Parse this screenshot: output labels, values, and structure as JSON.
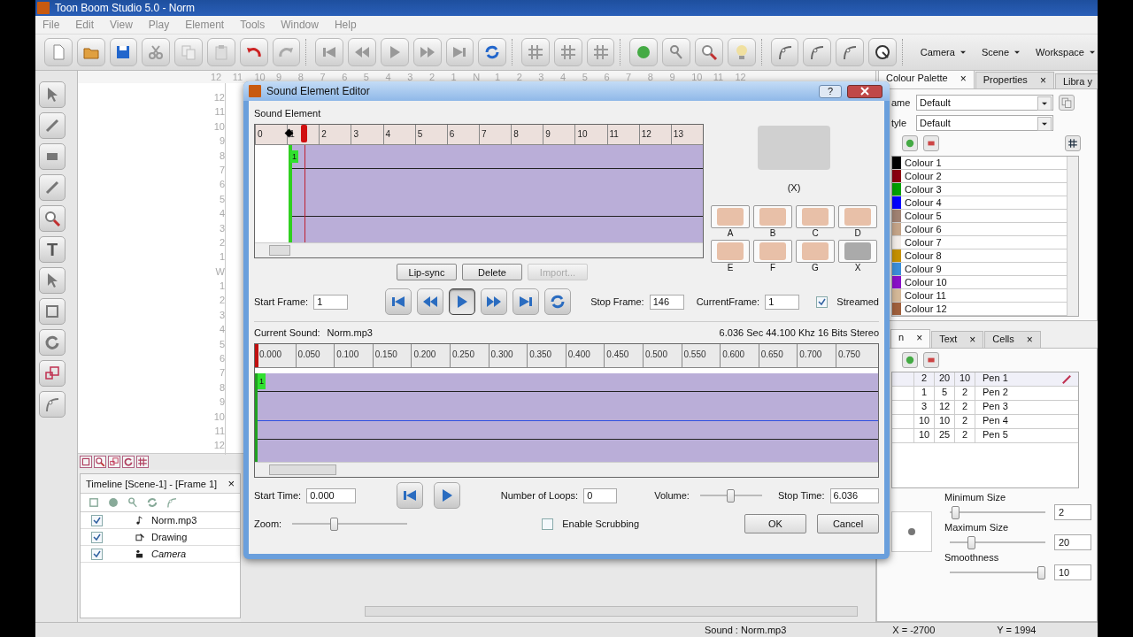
{
  "window": {
    "title": "Toon Boom Studio 5.0 - Norm"
  },
  "menu": [
    "File",
    "Edit",
    "View",
    "Play",
    "Element",
    "Tools",
    "Window",
    "Help"
  ],
  "toolbar_menus": [
    "Camera",
    "Scene",
    "Workspace"
  ],
  "text_tool": {
    "label": "T"
  },
  "canvas": {
    "top_ruler": [
      "12",
      "11",
      "10",
      "9",
      "8",
      "7",
      "6",
      "5",
      "4",
      "3",
      "2",
      "1",
      "N",
      "1",
      "2",
      "3",
      "4",
      "5",
      "6",
      "7",
      "8",
      "9",
      "10",
      "11",
      "12"
    ],
    "side_ruler": [
      "12",
      "11",
      "10",
      "9",
      "8",
      "7",
      "6",
      "5",
      "4",
      "3",
      "2",
      "1",
      "W",
      "1",
      "2",
      "3",
      "4",
      "5",
      "6",
      "7",
      "8",
      "9",
      "10",
      "11",
      "12"
    ]
  },
  "timeline": {
    "title": "Timeline [Scene-1] - [Frame 1]",
    "close": "×",
    "layers": [
      {
        "name": "Norm.mp3",
        "checked": true,
        "kind": "sound"
      },
      {
        "name": "Drawing",
        "checked": true,
        "kind": "drawing"
      },
      {
        "name": "Camera",
        "checked": true,
        "kind": "camera"
      }
    ]
  },
  "status_bar": [
    "Sound : Norm.mp3",
    "X = -2700",
    "Y = 1994"
  ],
  "right_panel": {
    "tabs": [
      {
        "label": "Colour Palette",
        "close": "×",
        "selected": true
      },
      {
        "label": "Properties",
        "close": "×",
        "selected": false
      },
      {
        "label": "Libra y",
        "selected": false
      }
    ],
    "name_label": "ame",
    "name_value": "Default",
    "style_label": "tyle",
    "style_value": "Default",
    "colours": [
      {
        "name": "Colour 1",
        "color": "#000000"
      },
      {
        "name": "Colour 2",
        "color": "#8b0010"
      },
      {
        "name": "Colour 3",
        "color": "#00a000"
      },
      {
        "name": "Colour 4",
        "color": "#0000ff"
      },
      {
        "name": "Colour 5",
        "color": "#a08272"
      },
      {
        "name": "Colour 6",
        "color": "#c4a488"
      },
      {
        "name": "Colour 7",
        "color": "#f2ece8"
      },
      {
        "name": "Colour 8",
        "color": "#c49000"
      },
      {
        "name": "Colour 9",
        "color": "#3c8ed8"
      },
      {
        "name": "Colour 10",
        "color": "#8a10c8"
      },
      {
        "name": "Colour 11",
        "color": "#d4b898"
      },
      {
        "name": "Colour 12",
        "color": "#a0603c"
      }
    ],
    "lower_tabs": [
      {
        "label": "n",
        "close": "×",
        "selected": true
      },
      {
        "label": "Text",
        "close": "×",
        "selected": false
      },
      {
        "label": "Cells",
        "close": "×",
        "selected": false
      }
    ],
    "pens": [
      {
        "cells": [
          "2",
          "20",
          "10"
        ],
        "name": "Pen 1",
        "selected": true
      },
      {
        "cells": [
          "1",
          "5",
          "2"
        ],
        "name": "Pen 2",
        "selected": false
      },
      {
        "cells": [
          "3",
          "12",
          "2"
        ],
        "name": "Pen 3",
        "selected": false
      },
      {
        "cells": [
          "10",
          "10",
          "2"
        ],
        "name": "Pen 4",
        "selected": false
      },
      {
        "cells": [
          "10",
          "25",
          "2"
        ],
        "name": "Pen 5",
        "selected": false
      }
    ],
    "sliders": [
      {
        "label": "Minimum Size",
        "value": "2",
        "level": 0.02
      },
      {
        "label": "Maximum Size",
        "value": "20",
        "level": 0.2
      },
      {
        "label": "Smoothness",
        "value": "10",
        "level": 1
      }
    ]
  },
  "dialog": {
    "title": "Sound Element Editor",
    "help": "?",
    "section_label": "Sound Element",
    "frame_ruler": [
      "0",
      "1",
      "2",
      "3",
      "4",
      "5",
      "6",
      "7",
      "8",
      "9",
      "10",
      "11",
      "12",
      "13"
    ],
    "keyframe": "1",
    "mouth_current": "(X)",
    "mouths": [
      "A",
      "B",
      "C",
      "D",
      "E",
      "F",
      "G",
      "X"
    ],
    "buttons": [
      {
        "label": "Lip-sync",
        "disabled": false
      },
      {
        "label": "Delete",
        "disabled": false
      },
      {
        "label": "Import...",
        "disabled": true
      }
    ],
    "start_frame_label": "Start Frame:",
    "start_frame": "1",
    "frame_transport": [
      {
        "selected": false
      },
      {
        "selected": false
      },
      {
        "selected": true
      },
      {
        "selected": false
      },
      {
        "selected": false
      },
      {
        "selected": false
      }
    ],
    "stop_frame_label": "Stop Frame:",
    "stop_frame": "146",
    "current_frame_label": "CurrentFrame:",
    "current_frame": "1",
    "streamed": {
      "label": "Streamed",
      "checked": true
    },
    "current_sound_label": "Current Sound:",
    "current_sound": "Norm.mp3",
    "sound_info": "6.036 Sec 44.100 Khz 16 Bits Stereo",
    "time_ruler": [
      "0.000",
      "0.050",
      "0.100",
      "0.150",
      "0.200",
      "0.250",
      "0.300",
      "0.350",
      "0.400",
      "0.450",
      "0.500",
      "0.550",
      "0.600",
      "0.650",
      "0.700",
      "0.750"
    ],
    "sound_keyframe": "1",
    "start_time_label": "Start Time:",
    "start_time": "0.000",
    "sound_transport": [
      {
        "selected": false
      },
      {
        "selected": false
      }
    ],
    "loops_label": "Number of Loops:",
    "loops": "0",
    "volume": {
      "label": "Volume:",
      "level": 0.5
    },
    "stop_time_label": "Stop Time:",
    "stop_time": "6.036",
    "zoom": {
      "label": "Zoom:",
      "level": 0.35
    },
    "scrubbing": {
      "label": "Enable Scrubbing",
      "checked": false
    },
    "ok": "OK",
    "cancel": "Cancel"
  }
}
